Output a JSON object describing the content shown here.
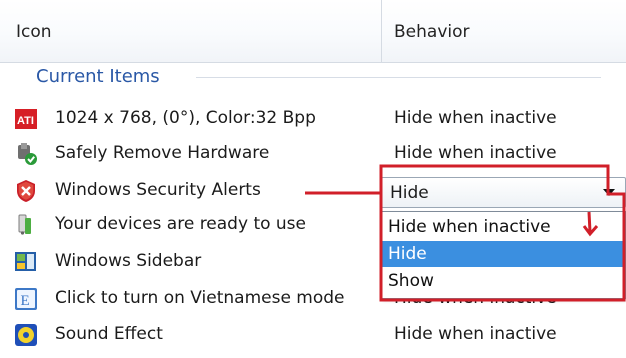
{
  "header": {
    "columns": [
      "Icon",
      "Behavior"
    ]
  },
  "group": {
    "label": "Current Items"
  },
  "rows": [
    {
      "label": "1024 x  768, (0°), Color:32 Bpp",
      "behavior": "Hide when inactive",
      "icon": "ati-icon"
    },
    {
      "label": "Safely Remove Hardware",
      "behavior": "Hide when inactive",
      "icon": "safely-remove-hardware-icon"
    },
    {
      "label": "Windows Security Alerts",
      "behavior": "",
      "icon": "security-alert-shield-icon"
    },
    {
      "label": "Your devices are ready to use",
      "behavior": "",
      "icon": "device-ready-icon"
    },
    {
      "label": "Windows Sidebar",
      "behavior": "",
      "icon": "windows-sidebar-icon"
    },
    {
      "label": "Click to turn on Vietnamese mode",
      "behavior": "Hide when inactive",
      "icon": "vietnamese-input-icon"
    },
    {
      "label": "Sound Effect",
      "behavior": "Hide when inactive",
      "icon": "sound-effect-icon"
    }
  ],
  "dropdown": {
    "selected": "Hide",
    "options": [
      "Hide when inactive",
      "Hide",
      "Show"
    ],
    "highlighted_index": 1
  },
  "colors": {
    "group_label": "#2a58a6",
    "selection": "#3b8fe0",
    "annotation": "#d11f29"
  }
}
